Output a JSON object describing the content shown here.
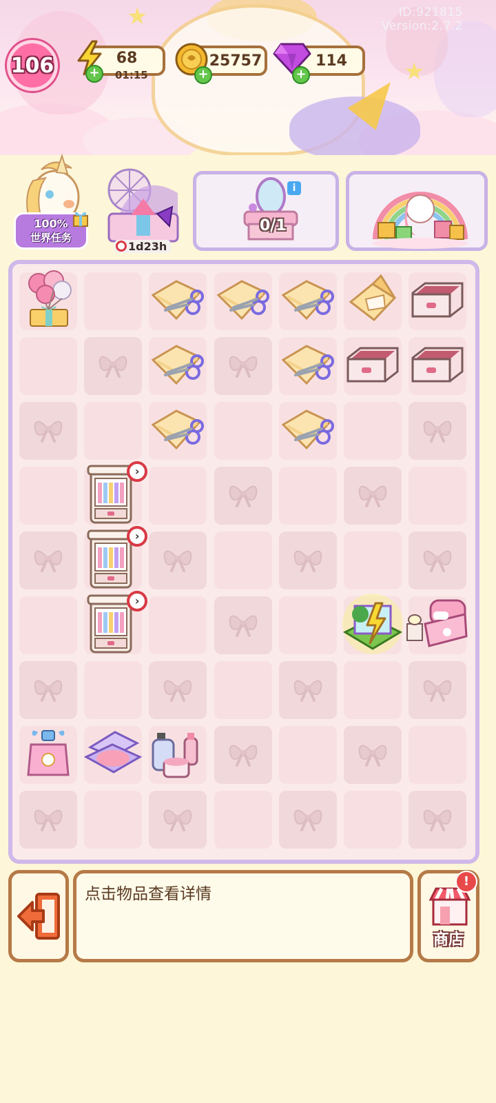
{
  "header": {
    "id_text": "ID:921815",
    "version_text": "Version:2.7.2",
    "level": "106",
    "energy": {
      "value": "68",
      "timer": "01:15",
      "icon": "lightning-icon"
    },
    "coins": {
      "value": "25757",
      "icon": "coin-icon"
    },
    "gems": {
      "value": "114",
      "icon": "gem-icon"
    }
  },
  "tasks": {
    "world_task_percent": "100%",
    "world_task_label": "世界任务",
    "event_timer": "1d23h",
    "vanity_order_count": "0/1",
    "info_badge": "i"
  },
  "board": {
    "cols": 7,
    "rows": 9,
    "items": [
      {
        "r": 0,
        "c": 0,
        "type": "balloon-gift"
      },
      {
        "r": 0,
        "c": 2,
        "type": "fabric-scissors"
      },
      {
        "r": 0,
        "c": 3,
        "type": "fabric-scissors"
      },
      {
        "r": 0,
        "c": 4,
        "type": "fabric-scissors"
      },
      {
        "r": 0,
        "c": 5,
        "type": "fabric-folded"
      },
      {
        "r": 0,
        "c": 6,
        "type": "drawer"
      },
      {
        "r": 1,
        "c": 2,
        "type": "fabric-scissors"
      },
      {
        "r": 1,
        "c": 4,
        "type": "fabric-scissors"
      },
      {
        "r": 1,
        "c": 5,
        "type": "drawer"
      },
      {
        "r": 1,
        "c": 6,
        "type": "drawer"
      },
      {
        "r": 2,
        "c": 2,
        "type": "fabric-scissors"
      },
      {
        "r": 2,
        "c": 4,
        "type": "fabric-scissors"
      },
      {
        "r": 3,
        "c": 1,
        "type": "wardrobe",
        "timer": true
      },
      {
        "r": 4,
        "c": 1,
        "type": "wardrobe",
        "timer": true
      },
      {
        "r": 5,
        "c": 1,
        "type": "wardrobe",
        "timer": true
      },
      {
        "r": 5,
        "c": 5,
        "type": "energy-house"
      },
      {
        "r": 5,
        "c": 6,
        "type": "pink-bed"
      },
      {
        "r": 7,
        "c": 0,
        "type": "perfume"
      },
      {
        "r": 7,
        "c": 1,
        "type": "blush-compact"
      },
      {
        "r": 7,
        "c": 2,
        "type": "skincare-set"
      }
    ],
    "locked": [
      [
        1,
        1
      ],
      [
        1,
        3
      ],
      [
        2,
        0
      ],
      [
        2,
        6
      ],
      [
        3,
        3
      ],
      [
        3,
        5
      ],
      [
        4,
        0
      ],
      [
        4,
        2
      ],
      [
        4,
        4
      ],
      [
        4,
        6
      ],
      [
        5,
        3
      ],
      [
        6,
        0
      ],
      [
        6,
        2
      ],
      [
        6,
        4
      ],
      [
        6,
        6
      ],
      [
        7,
        3
      ],
      [
        7,
        5
      ],
      [
        8,
        0
      ],
      [
        8,
        2
      ],
      [
        8,
        4
      ],
      [
        8,
        6
      ]
    ]
  },
  "bottom": {
    "detail_text": "点击物品查看详情",
    "shop_label": "商店",
    "shop_alert": "!"
  },
  "colors": {
    "accent_pink": "#ff6fa6",
    "frame_brown": "#b57a48",
    "board_border": "#cfb8ea",
    "energy_green": "#62c64a"
  }
}
